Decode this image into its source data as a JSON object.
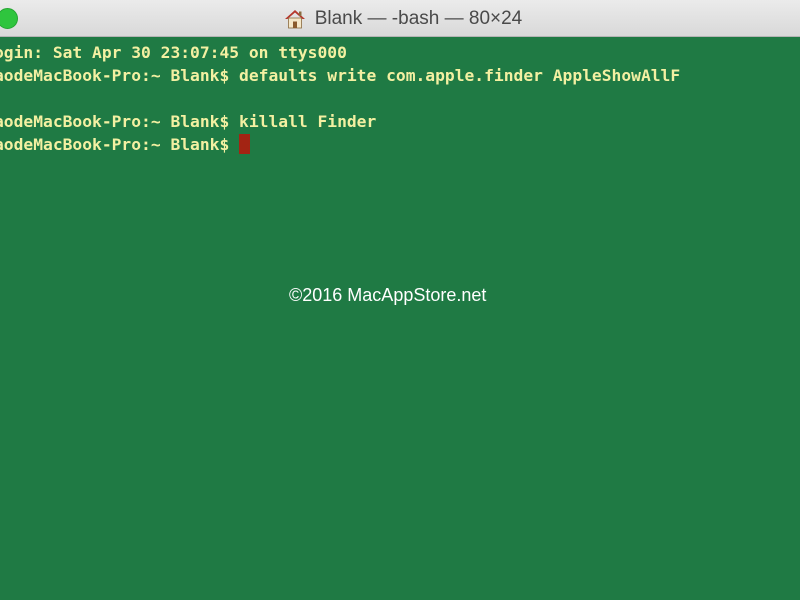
{
  "window": {
    "title": "Blank — -bash — 80×24",
    "title_icon": "home-icon",
    "colors": {
      "background": "#1f7a44",
      "text": "#f3f0a2",
      "cursor": "#a32413",
      "close_green": "#2fc53e"
    }
  },
  "terminal": {
    "lines": [
      "ogin: Sat Apr 30 23:07:45 on ttys000",
      "aodeMacBook-Pro:~ Blank$ defaults write com.apple.finder AppleShowAllF",
      "",
      "aodeMacBook-Pro:~ Blank$ killall Finder"
    ],
    "prompt": "aodeMacBook-Pro:~ Blank$ "
  },
  "watermark": "©2016 MacAppStore.net"
}
